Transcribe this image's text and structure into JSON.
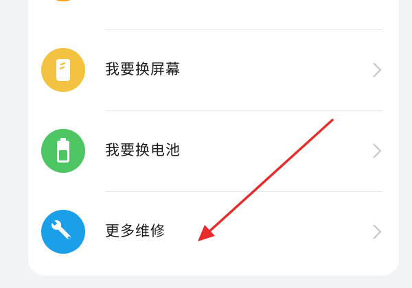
{
  "menu": {
    "items": [
      {
        "label": "我要换屏幕",
        "icon": "phone-screen-icon",
        "color": "#f2c240"
      },
      {
        "label": "我要换电池",
        "icon": "battery-icon",
        "color": "#4cc562"
      },
      {
        "label": "更多维修",
        "icon": "wrench-icon",
        "color": "#1a9fe8"
      }
    ],
    "partial_icon": {
      "icon": "partial-orange-icon",
      "color": "#f7a21b"
    }
  },
  "annotation": {
    "icon": "red-arrow-icon",
    "color": "#e82c2c"
  }
}
